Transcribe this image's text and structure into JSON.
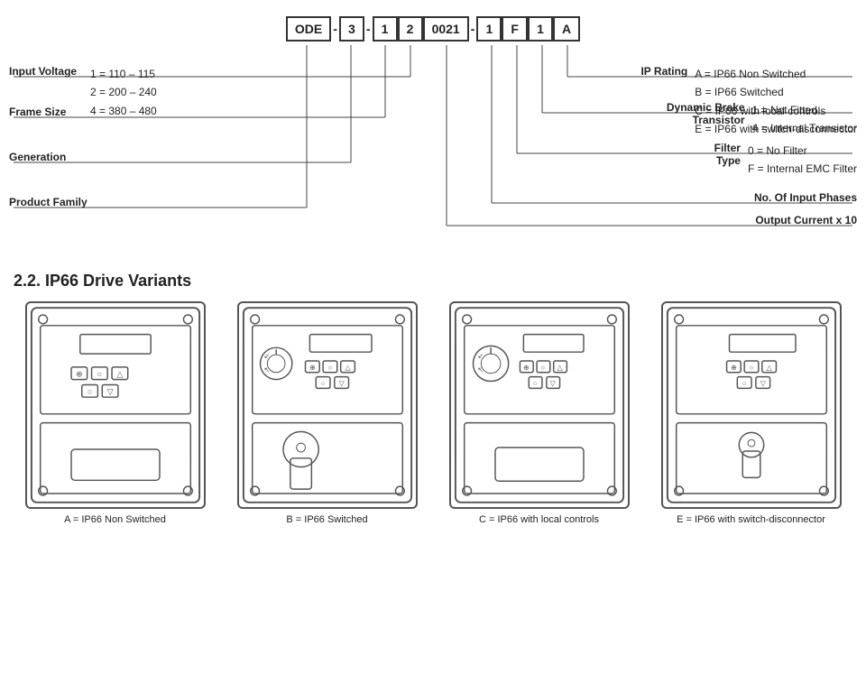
{
  "diagram": {
    "code_parts": [
      "ODE",
      "-",
      "3",
      "-",
      "1",
      "2",
      "0021",
      "-",
      "1",
      "F",
      "1",
      "A"
    ],
    "left_labels": [
      {
        "key": "Product Family",
        "values": []
      },
      {
        "key": "Generation",
        "values": []
      },
      {
        "key": "Frame Size",
        "values": []
      },
      {
        "key": "Input Voltage",
        "values": [
          "1 = 110 – 115",
          "2 = 200 – 240",
          "4 = 380 – 480"
        ]
      }
    ],
    "right_labels": [
      {
        "key": "IP Rating",
        "values": [
          "A = IP66 Non Switched",
          "B = IP66 Switched",
          "C = IP66 with local controls",
          "E = IP66 with switch-disconnector"
        ]
      },
      {
        "key_line1": "Dynamic Brake",
        "key_line2": "Transistor",
        "values": [
          "1 = Not Fitted",
          "4 = Internal Transistor"
        ]
      },
      {
        "key_line1": "Filter",
        "key_line2": "Type",
        "values": [
          "0 = No Filter",
          "F = Internal EMC Filter"
        ]
      },
      {
        "key": "No. Of Input Phases",
        "values": []
      },
      {
        "key": "Output Current x 10",
        "values": []
      }
    ]
  },
  "section22": {
    "title": "2.2. IP66 Drive Variants",
    "variants": [
      {
        "label": "A = IP66 Non Switched",
        "type": "A"
      },
      {
        "label": "B = IP66 Switched",
        "type": "B"
      },
      {
        "label": "C = IP66 with local controls",
        "type": "C"
      },
      {
        "label": "E = IP66 with switch-disconnector",
        "type": "E"
      }
    ]
  }
}
